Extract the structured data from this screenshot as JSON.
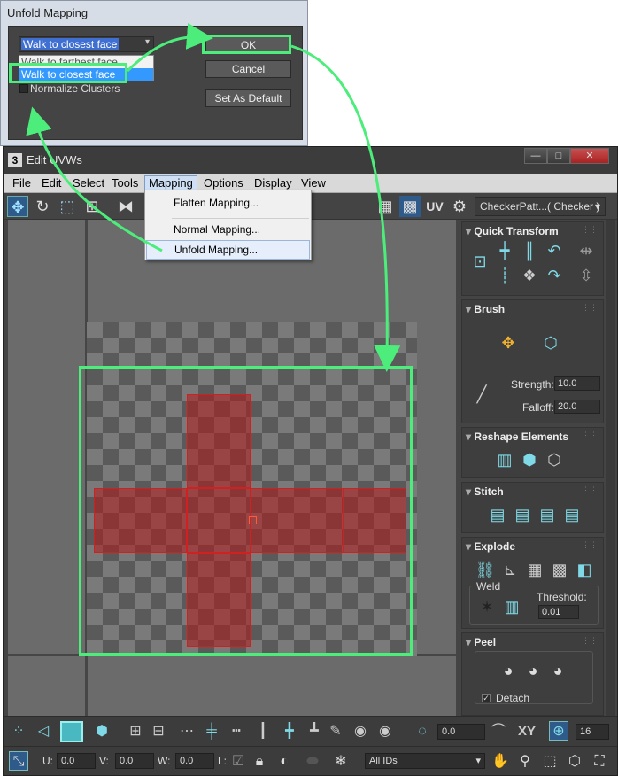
{
  "unfold_dialog": {
    "title": "Unfold Mapping",
    "walk_select_value": "Walk to closest face",
    "walk_options": [
      "Walk to farthest face",
      "Walk to closest face"
    ],
    "normalize_label": "Normalize Clusters",
    "ok_label": "OK",
    "cancel_label": "Cancel",
    "set_default_label": "Set As Default"
  },
  "window": {
    "app_icon": "3",
    "title": "Edit UVWs",
    "min_label": "—",
    "max_label": "□",
    "close_label": "✕"
  },
  "menubar": [
    "File",
    "Edit",
    "Select",
    "Tools",
    "Mapping",
    "Options",
    "Display",
    "View"
  ],
  "mapping_menu": [
    "Flatten Mapping...",
    "Normal Mapping...",
    "Unfold Mapping..."
  ],
  "toolbar_top": {
    "uv_label": "UV",
    "checker_select": "CheckerPatt...( Checker )"
  },
  "panel": {
    "quick_transform": "Quick Transform",
    "brush": "Brush",
    "strength_label": "Strength:",
    "strength_value": "10.0",
    "falloff_label": "Falloff:",
    "falloff_value": "20.0",
    "reshape": "Reshape Elements",
    "stitch": "Stitch",
    "explode": "Explode",
    "weld": "Weld",
    "threshold_label": "Threshold:",
    "threshold_value": "0.01",
    "peel": "Peel",
    "detach_label": "Detach"
  },
  "bottom": {
    "rotate_value": "0.0",
    "xy_label": "XY",
    "grid_value": "16",
    "u_label": "U:",
    "u_value": "0.0",
    "v_label": "V:",
    "v_value": "0.0",
    "w_label": "W:",
    "w_value": "0.0",
    "l_label": "L:",
    "ids_select": "All IDs"
  },
  "colors": {
    "highlight": "#4ced7a",
    "uv_shell": "#b41919",
    "menu_bar": "#d9d9d9",
    "dialog_bg": "#444444"
  }
}
